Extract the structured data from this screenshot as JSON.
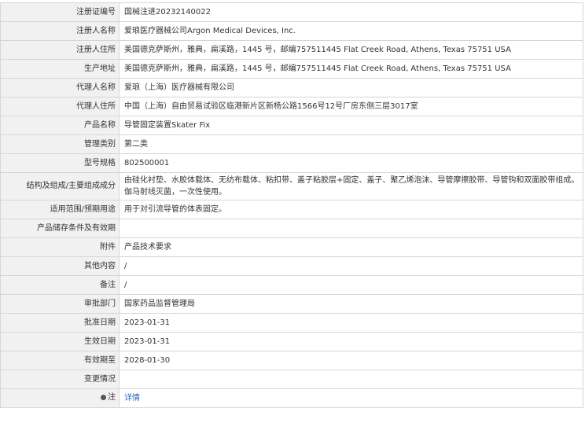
{
  "accent_link_color": "#2a66b0",
  "rows": [
    {
      "label": "注册证编号",
      "value": "国械注进20232140022"
    },
    {
      "label": "注册人名称",
      "value": "爱琅医疗器械公司Argon Medical Devices, Inc."
    },
    {
      "label": "注册人住所",
      "value": "美国德克萨斯州，雅典，扁溪路，1445 号，邮编757511445 Flat Creek Road, Athens, Texas 75751 USA"
    },
    {
      "label": "生产地址",
      "value": "美国德克萨斯州，雅典，扁溪路，1445 号，邮编757511445 Flat Creek Road, Athens, Texas 75751 USA"
    },
    {
      "label": "代理人名称",
      "value": "爱琅（上海）医疗器械有限公司"
    },
    {
      "label": "代理人住所",
      "value": "中国（上海）自由贸易试验区临港新片区新杨公路1566号12号厂房东侧三层3017室"
    },
    {
      "label": "产品名称",
      "value": "导管固定装置Skater Fix"
    },
    {
      "label": "管理类别",
      "value": "第二类"
    },
    {
      "label": "型号规格",
      "value": "802500001"
    },
    {
      "label": "结构及组成/主要组成成分",
      "value": "由硅化衬垫、水胶体载体、无纺布载体、粘扣带、盖子粘胶层+固定、盖子、聚乙烯泡沫、导管摩擦胶带、导管钩和双面胶带组成。伽马射线灭菌，一次性使用。"
    },
    {
      "label": "适用范围/预期用途",
      "value": "用于对引流导管的体表固定。"
    },
    {
      "label": "产品储存条件及有效期",
      "value": ""
    },
    {
      "label": "附件",
      "value": "产品技术要求"
    },
    {
      "label": "其他内容",
      "value": "/"
    },
    {
      "label": "备注",
      "value": "/"
    },
    {
      "label": "审批部门",
      "value": "国家药品监督管理局"
    },
    {
      "label": "批准日期",
      "value": "2023-01-31"
    },
    {
      "label": "生效日期",
      "value": "2023-01-31"
    },
    {
      "label": "有效期至",
      "value": "2028-01-30"
    },
    {
      "label": "变更情况",
      "value": ""
    }
  ],
  "note_row": {
    "label": "注",
    "link_text": "详情",
    "icon": "dot-icon"
  }
}
